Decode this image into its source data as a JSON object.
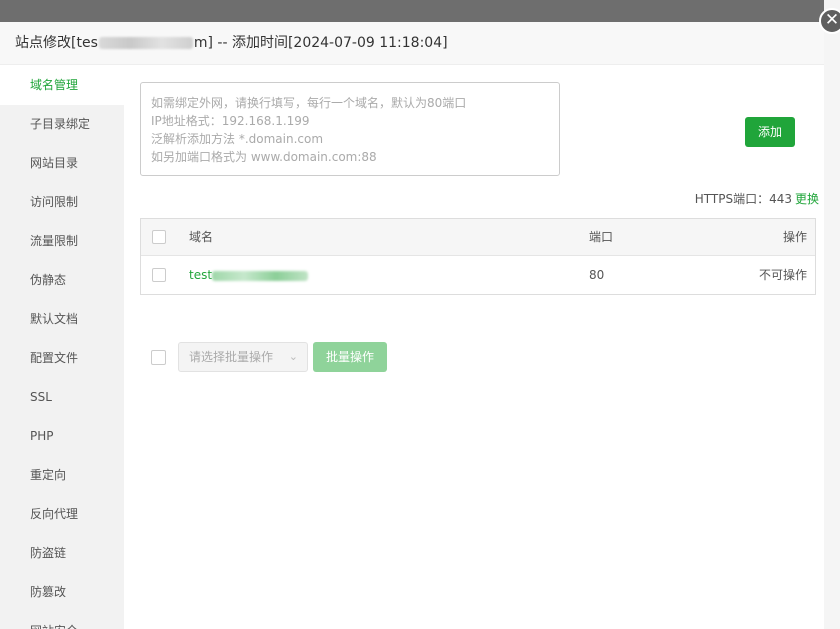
{
  "modal": {
    "title_prefix": "站点修改[tes",
    "title_suffix": "m] -- 添加时间[2024-07-09 11:18:04]",
    "close_symbol": "✕"
  },
  "sidebar": {
    "items": [
      {
        "label": "域名管理",
        "active": true
      },
      {
        "label": "子目录绑定"
      },
      {
        "label": "网站目录"
      },
      {
        "label": "访问限制"
      },
      {
        "label": "流量限制"
      },
      {
        "label": "伪静态"
      },
      {
        "label": "默认文档"
      },
      {
        "label": "配置文件"
      },
      {
        "label": "SSL"
      },
      {
        "label": "PHP"
      },
      {
        "label": "重定向"
      },
      {
        "label": "反向代理"
      },
      {
        "label": "防盗链"
      },
      {
        "label": "防篡改"
      },
      {
        "label": "网站安全"
      }
    ]
  },
  "domain_form": {
    "placeholder_lines": [
      "如需绑定外网，请换行填写，每行一个域名，默认为80端口",
      "IP地址格式：192.168.1.199",
      "泛解析添加方法 *.domain.com",
      "如另加端口格式为 www.domain.com:88"
    ],
    "add_label": "添加"
  },
  "https": {
    "label": "HTTPS端口：443",
    "change_label": "更换"
  },
  "table": {
    "headers": {
      "domain": "域名",
      "port": "端口",
      "action": "操作"
    },
    "rows": [
      {
        "domain_prefix": "test",
        "port": "80",
        "action": "不可操作"
      }
    ]
  },
  "batch": {
    "select_placeholder": "请选择批量操作",
    "button_label": "批量操作"
  },
  "colors": {
    "accent": "#20a53a"
  }
}
